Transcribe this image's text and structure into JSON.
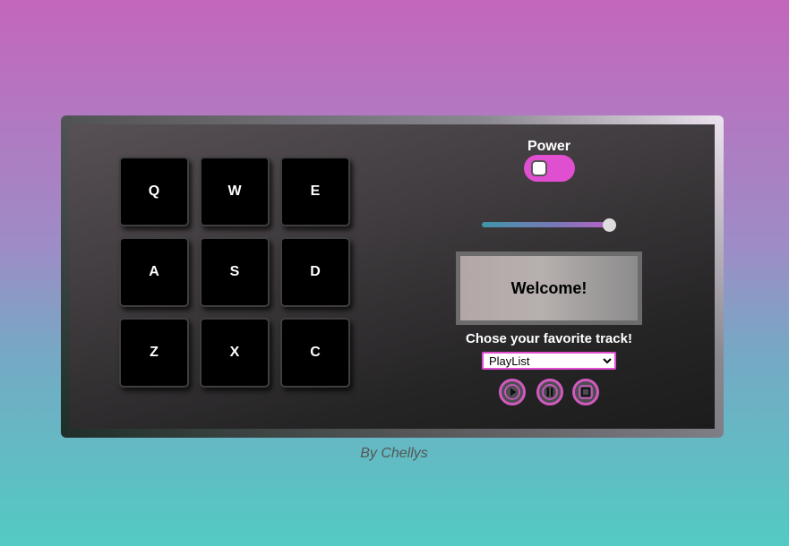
{
  "drum_pads": [
    {
      "key": "Q"
    },
    {
      "key": "W"
    },
    {
      "key": "E"
    },
    {
      "key": "A"
    },
    {
      "key": "S"
    },
    {
      "key": "D"
    },
    {
      "key": "Z"
    },
    {
      "key": "X"
    },
    {
      "key": "C"
    }
  ],
  "power": {
    "label": "Power",
    "on": true
  },
  "volume": {
    "value": 1.0
  },
  "display": {
    "text": "Welcome!"
  },
  "track_chooser": {
    "label": "Chose your favorite track!",
    "selected": "PlayList"
  },
  "controls": [
    {
      "icon": "play-icon"
    },
    {
      "icon": "pause-icon"
    },
    {
      "icon": "stop-icon"
    }
  ],
  "footer": {
    "credit": "By Chellys"
  },
  "colors": {
    "accent": "#e04fd0",
    "control_border": "#d25abf",
    "pad_bg": "#000000"
  }
}
